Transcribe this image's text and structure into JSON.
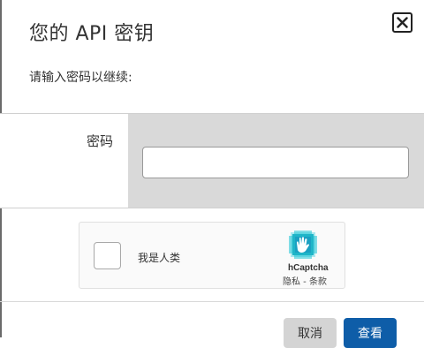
{
  "dialog": {
    "title": "您的 API 密钥",
    "prompt": "请输入密码以继续:"
  },
  "form": {
    "password_label": "密码",
    "password_value": ""
  },
  "captcha": {
    "label": "我是人类",
    "brand": "hCaptcha",
    "links": "隐私 - 条款",
    "brand_color": "#1ec5d6"
  },
  "buttons": {
    "cancel": "取消",
    "view": "查看",
    "primary_color": "#0e5da8"
  },
  "icons": {
    "close": "close-icon",
    "captcha_logo": "hcaptcha-hand-icon"
  }
}
